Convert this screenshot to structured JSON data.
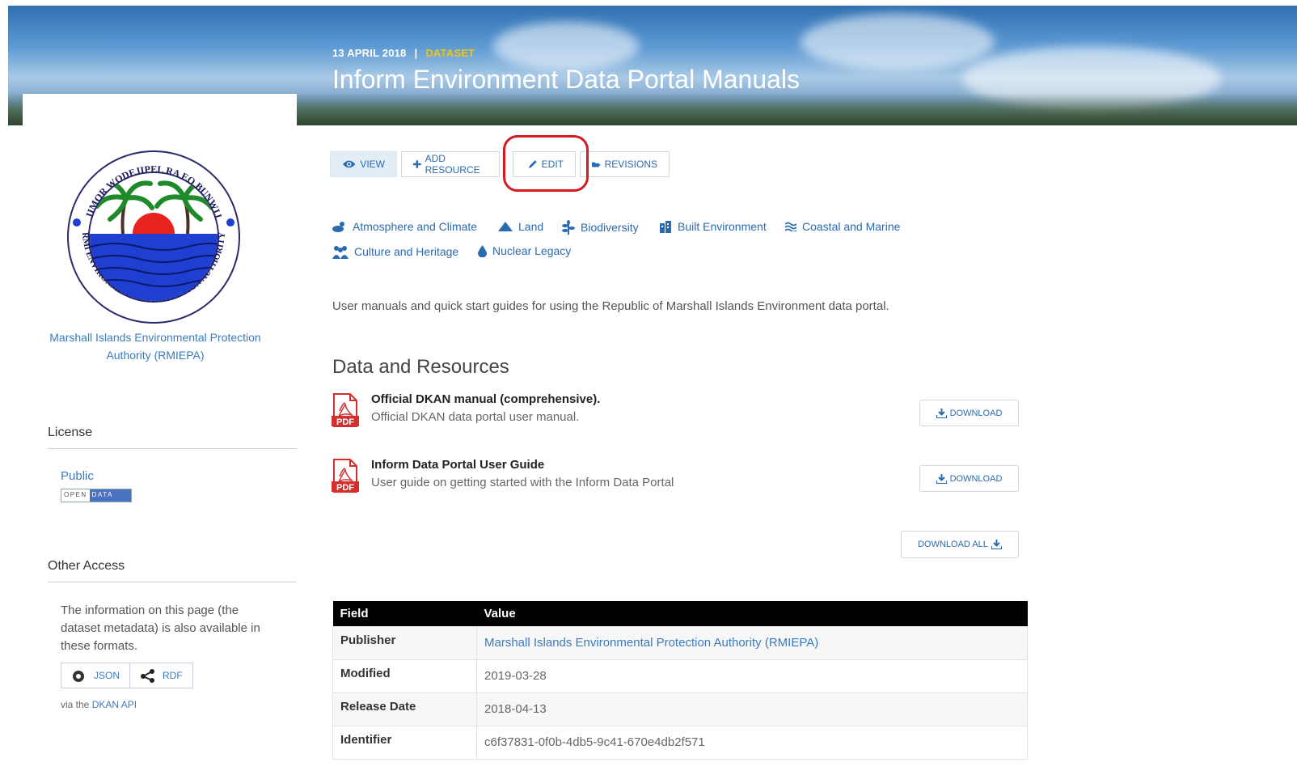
{
  "hero": {
    "date": "13 APRIL 2018",
    "separator": "|",
    "type": "DATASET",
    "title": "Inform Environment Data Portal Manuals"
  },
  "sidebar": {
    "org_name": "Marshall Islands Environmental Protection Authority (RMIEPA)",
    "logo_text_top": "JIMOR WODEJIPEL RA EO BUNWIJ",
    "logo_text_bottom": "RMI ENVIRONMENTAL PROTECTION AUTHORITY",
    "license_heading": "License",
    "license_value": "Public",
    "open_data_badge": [
      "OPEN",
      "DATA"
    ],
    "other_access_heading": "Other Access",
    "other_access_text": "The information on this page (the dataset metadata) is also available in these formats.",
    "formats": [
      {
        "label": "JSON",
        "icon": "json-icon"
      },
      {
        "label": "RDF",
        "icon": "share-icon"
      }
    ],
    "via_prefix": "via the",
    "via_link": "DKAN API"
  },
  "actions": [
    {
      "label": "VIEW",
      "icon": "eye-icon",
      "active": true
    },
    {
      "label": "ADD RESOURCE",
      "icon": "plus-icon",
      "active": false
    },
    {
      "label": "EDIT",
      "icon": "pencil-icon",
      "active": false
    },
    {
      "label": "REVISIONS",
      "icon": "folder-open-icon",
      "active": false
    }
  ],
  "topics": [
    {
      "label": "Atmosphere and Climate",
      "icon": "weather-icon"
    },
    {
      "label": "Land",
      "icon": "mountain-icon"
    },
    {
      "label": "Biodiversity",
      "icon": "plant-icon"
    },
    {
      "label": "Built Environment",
      "icon": "building-icon"
    },
    {
      "label": "Coastal and Marine",
      "icon": "waves-icon"
    },
    {
      "label": "Culture and Heritage",
      "icon": "people-icon"
    },
    {
      "label": "Nuclear Legacy",
      "icon": "drop-icon"
    }
  ],
  "description": "User manuals and quick start guides for using the Republic of Marshall Islands Environment data portal.",
  "resources_heading": "Data and Resources",
  "resources": [
    {
      "title": "Official DKAN manual (comprehensive).",
      "desc": "Official DKAN data portal user manual.",
      "format": "PDF",
      "button": "DOWNLOAD"
    },
    {
      "title": "Inform Data Portal User Guide",
      "desc": "User guide on getting started with the Inform Data Portal",
      "format": "PDF",
      "button": "DOWNLOAD"
    }
  ],
  "download_all": "DOWNLOAD ALL",
  "table": {
    "headers": [
      "Field",
      "Value"
    ],
    "rows": [
      {
        "field": "Publisher",
        "value": "Marshall Islands Environmental Protection Authority (RMIEPA)",
        "link": true
      },
      {
        "field": "Modified",
        "value": "2019-03-28"
      },
      {
        "field": "Release Date",
        "value": "2018-04-13"
      },
      {
        "field": "Identifier",
        "value": "c6f37831-0f0b-4db5-9c41-670e4db2f571"
      }
    ]
  },
  "colors": {
    "link": "#2a6ab0",
    "dataset_type": "#f1c40f",
    "highlight_ring": "#d71920",
    "pdf_red": "#d32f2f"
  }
}
